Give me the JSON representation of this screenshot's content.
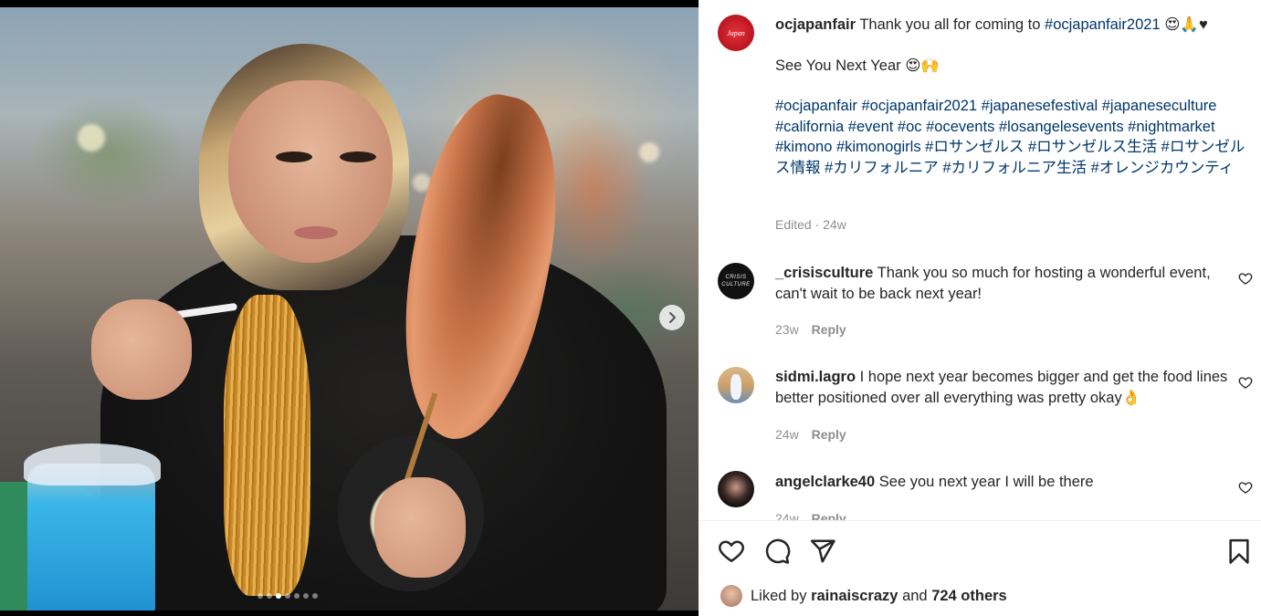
{
  "post": {
    "author": "ocjapanfair",
    "avatar_mark": "Japan",
    "caption_text": "Thank you all for coming to",
    "caption_tag": "#ocjapanfair2021",
    "caption_emoji": "😍🙏♥",
    "line2": "See You Next Year 😍🙌",
    "hashtags": "#ocjapanfair #ocjapanfair2021 #japanesefestival #japaneseculture #california #event #oc #ocevents #losangelesevents #nightmarket #kimono #kimonogirls #ロサンゼルス #ロサンゼルス生活 #ロサンゼルス情報 #カリフォルニア #カリフォルニア生活 #オレンジカウンティ",
    "edited_label": "Edited · 24w"
  },
  "comments": [
    {
      "user": "_crisisculture",
      "avatar_text": "CRISIS CULTURE",
      "text": "Thank you so much for hosting a wonderful event, can't wait to be back next year!",
      "age": "23w",
      "reply": "Reply"
    },
    {
      "user": "sidmi.lagro",
      "text": "I hope next year becomes bigger and get the food lines better positioned over all everything was pretty okay👌",
      "age": "24w",
      "reply": "Reply"
    },
    {
      "user": "angelclarke40",
      "text": "See you next year I will be there",
      "age": "24w",
      "reply": "Reply"
    }
  ],
  "likes": {
    "prefix": "Liked by",
    "user": "rainaiscrazy",
    "joiner": "and",
    "others": "724 others"
  },
  "carousel": {
    "total": 7,
    "active_index": 2
  },
  "icons": {
    "next": "chevron-right-icon",
    "like": "heart-icon",
    "comment": "comment-icon",
    "share": "paper-plane-icon",
    "save": "bookmark-icon"
  },
  "colors": {
    "hashtag": "#00376b",
    "muted": "#8e8e8e",
    "text": "#262626"
  }
}
